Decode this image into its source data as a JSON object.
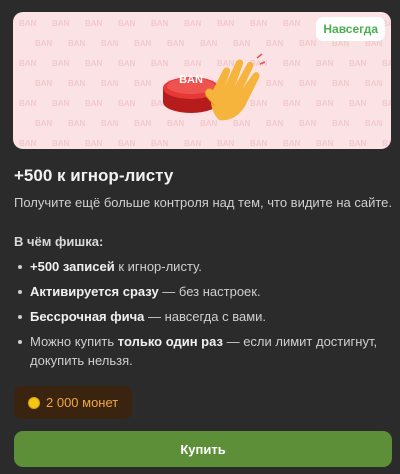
{
  "banner": {
    "badge": "Навсегда",
    "pattern_text": "BAN",
    "button_label": "BAN",
    "icons": [
      "ban-button-icon",
      "waving-hand-icon"
    ]
  },
  "title": "+500 к игнор-листу",
  "subtitle": "Получите ещё больше контроля над тем, что видите на сайте.",
  "features_heading": "В чём фишка:",
  "features": [
    {
      "bold": "+500 записей",
      "text": " к игнор-листу."
    },
    {
      "bold": "Активируется сразу",
      "text": " — без настроек."
    },
    {
      "bold": "Бессрочная фича",
      "text": " — навсегда с вами."
    },
    {
      "pre": "Можно купить ",
      "bold": "только один раз",
      "text": " — если лимит достигнут, докупить нельзя."
    }
  ],
  "price": {
    "label": "2 000 монет",
    "icon": "coin-icon"
  },
  "buy_button": "Купить",
  "colors": {
    "page_bg": "#2b2b2b",
    "banner_bg": "#fbe3e5",
    "badge_text": "#4caf50",
    "price_bg": "#3a2410",
    "price_text": "#f0a640",
    "buy_bg": "#5c8f37"
  }
}
